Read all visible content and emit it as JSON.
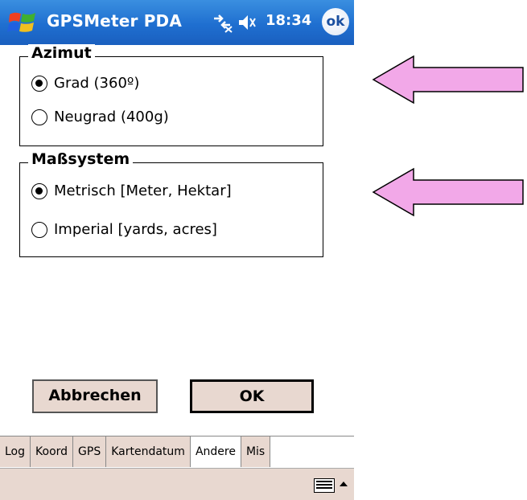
{
  "titlebar": {
    "title": "GPSMeter PDA",
    "time": "18:34",
    "ok_label": "ok",
    "start_icon": "windows-flag-icon",
    "signal_icon": "connectivity-icon",
    "volume_icon": "speaker-icon"
  },
  "azimut": {
    "legend": "Azimut",
    "options": [
      {
        "label": "Grad (360º)",
        "checked": true
      },
      {
        "label": "Neugrad (400g)",
        "checked": false
      }
    ]
  },
  "masssystem": {
    "legend": "Maßsystem",
    "options": [
      {
        "label": "Metrisch [Meter, Hektar]",
        "checked": true
      },
      {
        "label": "Imperial [yards, acres]",
        "checked": false
      }
    ]
  },
  "buttons": {
    "cancel": "Abbrechen",
    "ok": "OK"
  },
  "tabs": [
    {
      "label": "Log",
      "active": false
    },
    {
      "label": "Koord",
      "active": false
    },
    {
      "label": "GPS",
      "active": false
    },
    {
      "label": "Kartendatum",
      "active": false
    },
    {
      "label": "Andere",
      "active": true
    },
    {
      "label": "Mis",
      "active": false
    }
  ],
  "colors": {
    "titlebar": "#1f6fd0",
    "button_face": "#e8d8d0",
    "arrow_fill": "#f2a8e8"
  },
  "annotations": {
    "arrow_icon": "left-arrow-icon"
  }
}
